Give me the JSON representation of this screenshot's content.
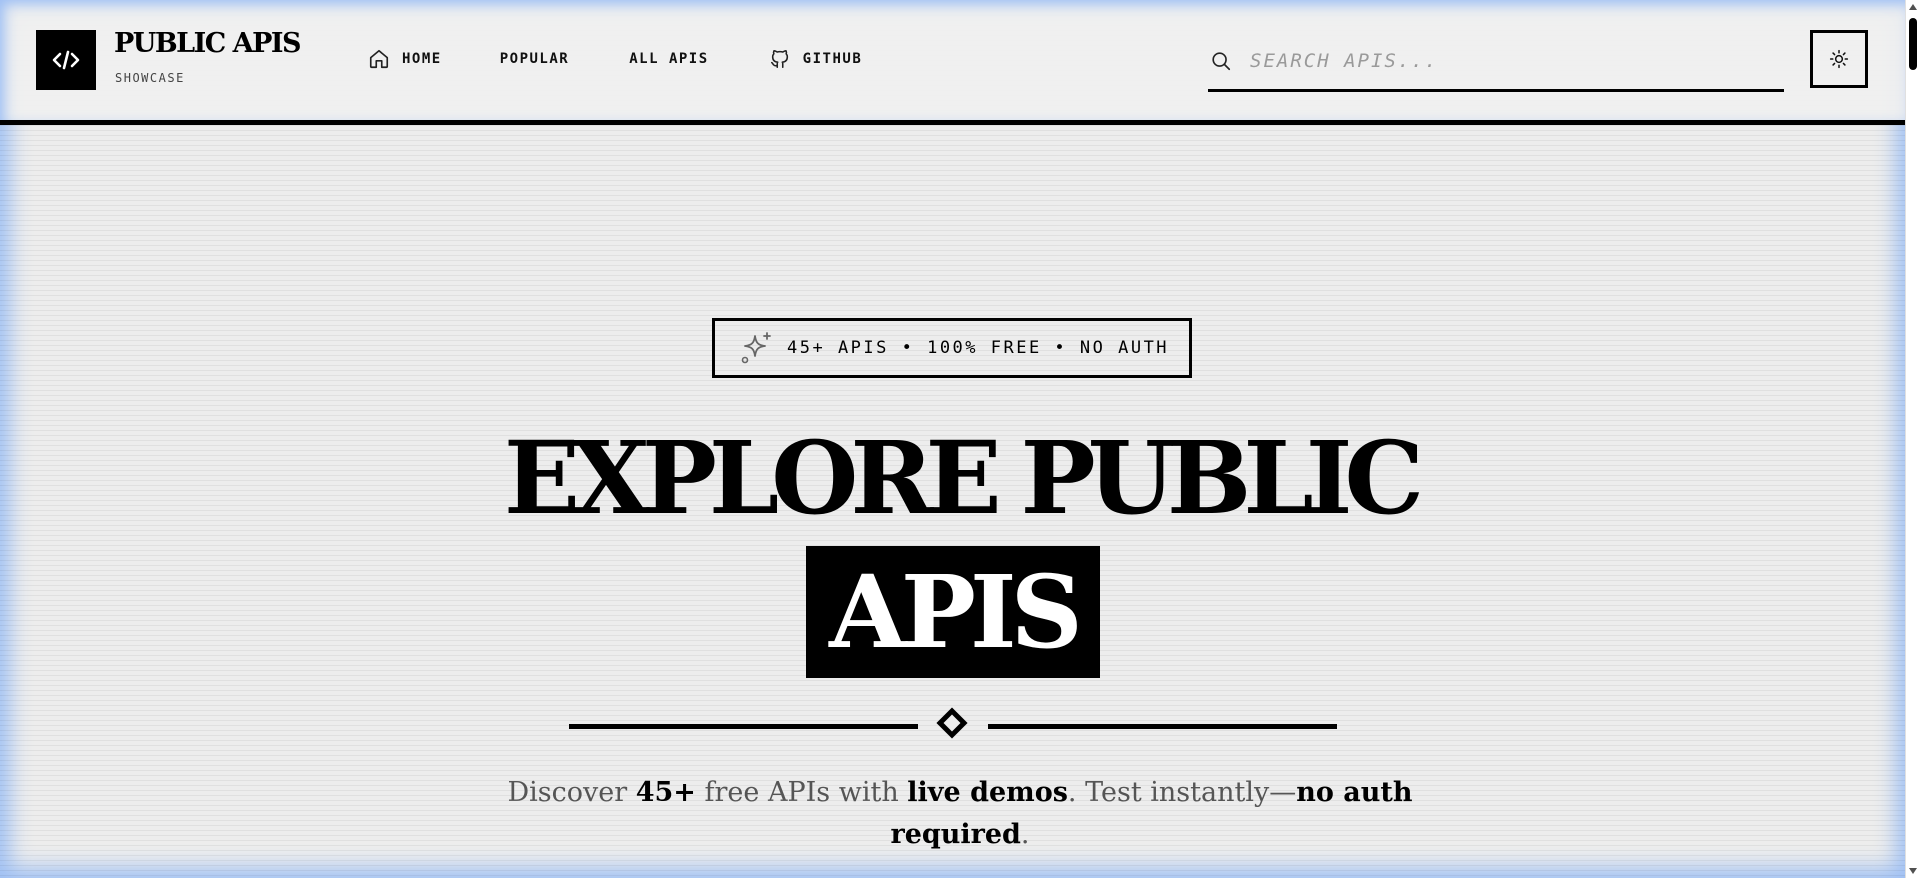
{
  "brand": {
    "title": "PUBLIC APIS",
    "subtitle": "SHOWCASE",
    "logo_icon": "code-brackets-icon"
  },
  "nav": {
    "items": [
      {
        "label": "HOME",
        "icon": "home-icon"
      },
      {
        "label": "POPULAR"
      },
      {
        "label": "ALL APIS"
      },
      {
        "label": "GITHUB",
        "icon": "github-icon"
      }
    ]
  },
  "search": {
    "placeholder": "SEARCH APIS...",
    "value": "",
    "icon": "search-icon"
  },
  "theme_toggle": {
    "icon": "sun-icon"
  },
  "hero": {
    "badge_icon": "sparkle-icon",
    "badge_text": "45+ APIS • 100% FREE • NO AUTH",
    "title_line1": "EXPLORE PUBLIC",
    "title_line2": "APIS",
    "tagline": {
      "p1": "Discover ",
      "b1": "45+",
      "p2": " free APIs with ",
      "b2": "live demos",
      "p3": ". Test instantly—",
      "b3": "no auth required",
      "p4": "."
    }
  },
  "colors": {
    "background": "#ededed",
    "ink": "#000000",
    "accent_glow": "#9fc0f4",
    "muted_text": "#555555"
  }
}
